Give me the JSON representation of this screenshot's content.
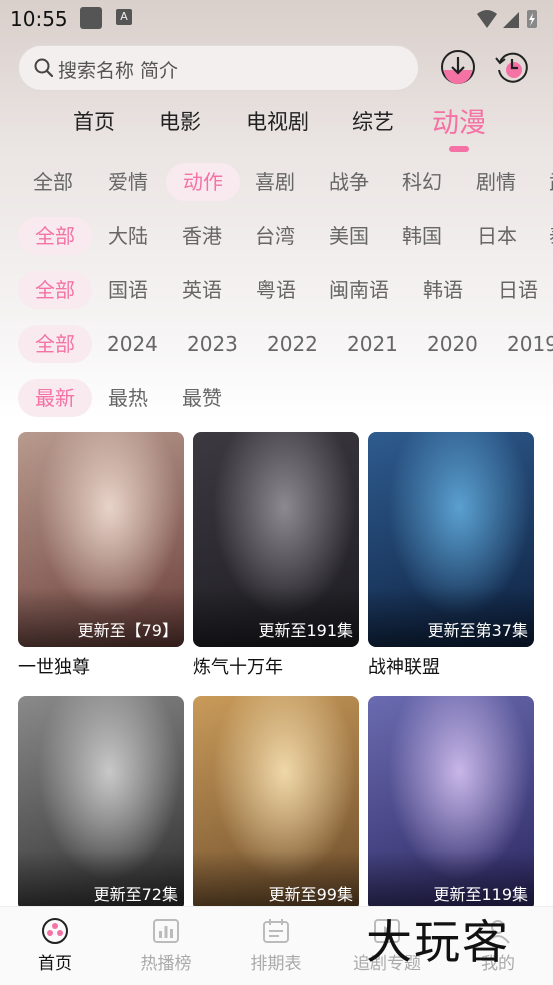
{
  "status": {
    "time": "10:55"
  },
  "search": {
    "placeholder": "搜索名称 简介"
  },
  "main_tabs": [
    {
      "label": "首页"
    },
    {
      "label": "电影"
    },
    {
      "label": "电视剧"
    },
    {
      "label": "综艺"
    },
    {
      "label": "动漫",
      "active": true
    }
  ],
  "filters": {
    "genre": [
      "全部",
      "爱情",
      "动作",
      "喜剧",
      "战争",
      "科幻",
      "剧情",
      "武"
    ],
    "region": [
      "全部",
      "大陆",
      "香港",
      "台湾",
      "美国",
      "韩国",
      "日本",
      "泰"
    ],
    "language": [
      "全部",
      "国语",
      "英语",
      "粤语",
      "闽南语",
      "韩语",
      "日语"
    ],
    "year": [
      "全部",
      "2024",
      "2023",
      "2022",
      "2021",
      "2020",
      "2019"
    ],
    "sort": [
      "最新",
      "最热",
      "最赞"
    ]
  },
  "items": [
    {
      "title": "一世独尊",
      "badge": "更新至【79】",
      "colors": [
        "#b89a8e",
        "#6b3f3a",
        "#e8d3c8"
      ]
    },
    {
      "title": "炼气十万年",
      "badge": "更新至191集",
      "colors": [
        "#3c3a40",
        "#1d1c22",
        "#8c8a90"
      ]
    },
    {
      "title": "战神联盟",
      "badge": "更新至第37集",
      "colors": [
        "#2e5b8e",
        "#0e2140",
        "#5aa0d0"
      ]
    },
    {
      "title": "",
      "badge": "更新至72集",
      "colors": [
        "#8a8a8a",
        "#2c2c2c",
        "#c8c8c8"
      ]
    },
    {
      "title": "",
      "badge": "更新至99集",
      "colors": [
        "#c99b5a",
        "#6a4a2a",
        "#f0d8a8"
      ]
    },
    {
      "title": "",
      "badge": "更新至119集",
      "colors": [
        "#6a6bb0",
        "#2b2660",
        "#c8b6e8"
      ]
    }
  ],
  "bottom_nav": [
    {
      "label": "首页",
      "active": true
    },
    {
      "label": "热播榜"
    },
    {
      "label": "排期表"
    },
    {
      "label": "追剧专题"
    },
    {
      "label": "我的"
    }
  ],
  "watermark": "大玩客",
  "accent": "#f472a4"
}
